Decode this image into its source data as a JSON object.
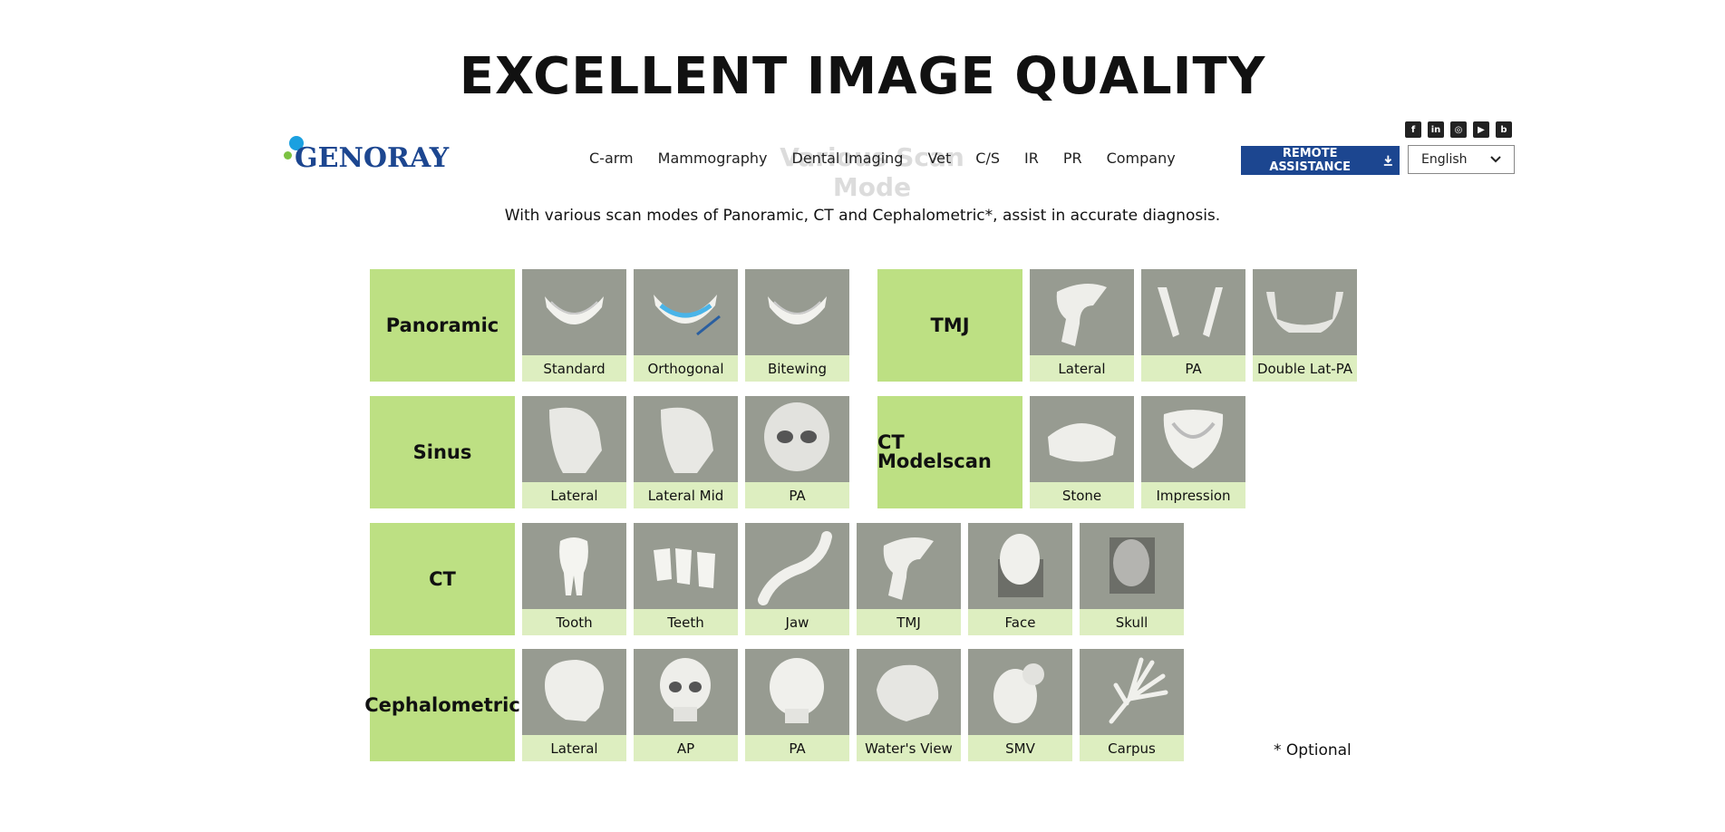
{
  "headline": "EXCELLENT IMAGE QUALITY",
  "ghost_title": "Various Scan Mode",
  "brand": {
    "name": "GENORAY"
  },
  "nav": [
    "C-arm",
    "Mammography",
    "Dental Imaging",
    "Vet",
    "C/S",
    "IR",
    "PR",
    "Company"
  ],
  "social": [
    {
      "icon": "facebook-icon",
      "glyph": "f"
    },
    {
      "icon": "linkedin-icon",
      "glyph": "in"
    },
    {
      "icon": "instagram-icon",
      "glyph": "◎"
    },
    {
      "icon": "youtube-icon",
      "glyph": "▶"
    },
    {
      "icon": "blog-icon",
      "glyph": "b"
    }
  ],
  "remote_assistance": {
    "label": "REMOTE ASSISTANCE",
    "icon": "download-icon"
  },
  "language": {
    "selected": "English",
    "icon": "chevron-down-icon"
  },
  "subtitle": "With various scan modes of Panoramic, CT and Cephalometric*, assist in accurate diagnosis.",
  "groups": [
    {
      "category": "Panoramic",
      "items": [
        "Standard",
        "Orthogonal",
        "Bitewing"
      ]
    },
    {
      "category": "TMJ",
      "items": [
        "Lateral",
        "PA",
        "Double Lat-PA"
      ]
    },
    {
      "category": "Sinus",
      "items": [
        "Lateral",
        "Lateral Mid",
        "PA"
      ]
    },
    {
      "category": "CT Modelscan",
      "items": [
        "Stone",
        "Impression"
      ]
    },
    {
      "category": "CT",
      "items": [
        "Tooth",
        "Teeth",
        "Jaw",
        "TMJ",
        "Face",
        "Skull"
      ]
    },
    {
      "category": "Cephalometric",
      "items": [
        "Lateral",
        "AP",
        "PA",
        "Water's View",
        "SMV",
        "Carpus"
      ]
    }
  ],
  "footnote": "* Optional",
  "colors": {
    "brand_blue": "#1c4690",
    "category_green": "#bde083",
    "label_green": "#ddeec0",
    "tile_gray": "#979b91"
  }
}
